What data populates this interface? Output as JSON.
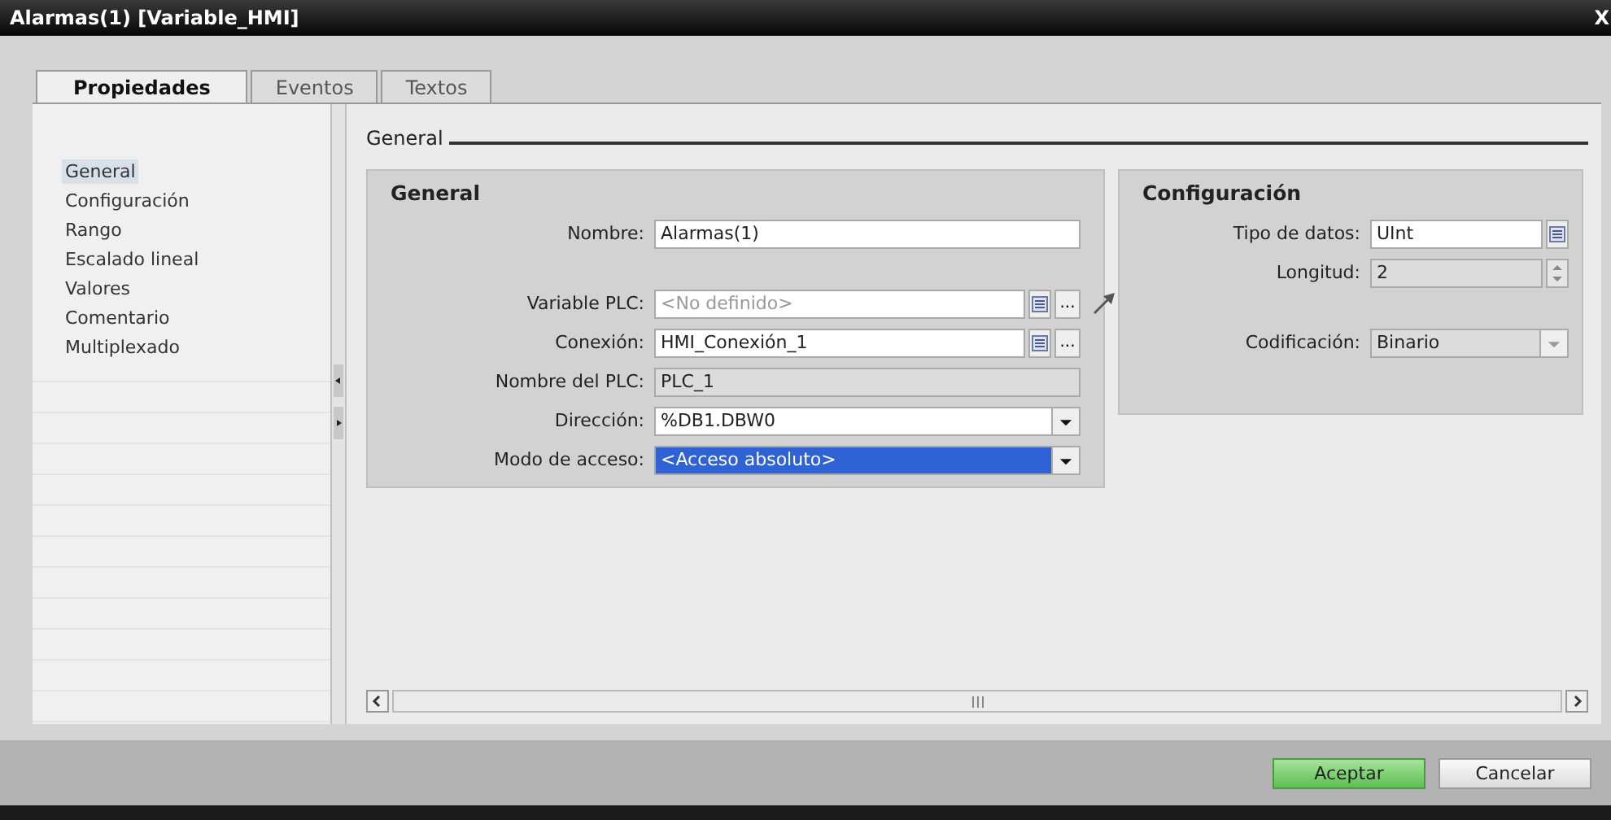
{
  "window": {
    "title": "Alarmas(1) [Variable_HMI]",
    "close": "X"
  },
  "tabs": [
    {
      "label": "Propiedades",
      "selected": true
    },
    {
      "label": "Eventos",
      "selected": false
    },
    {
      "label": "Textos",
      "selected": false
    }
  ],
  "sidebar": {
    "items": [
      {
        "label": "General",
        "selected": true
      },
      {
        "label": "Configuración",
        "selected": false
      },
      {
        "label": "Rango",
        "selected": false
      },
      {
        "label": "Escalado lineal",
        "selected": false
      },
      {
        "label": "Valores",
        "selected": false
      },
      {
        "label": "Comentario",
        "selected": false
      },
      {
        "label": "Multiplexado",
        "selected": false
      }
    ]
  },
  "section_title": "General",
  "groups": [
    {
      "title": "General",
      "sections": [
        [
          {
            "label": "Nombre:",
            "kind": "text",
            "value": "Alarmas(1)"
          }
        ],
        [
          {
            "label": "Variable PLC:",
            "kind": "tag",
            "placeholder": "<No definido>",
            "browse": "...",
            "jump": true
          },
          {
            "label": "Conexión:",
            "kind": "tag",
            "value": "HMI_Conexión_1",
            "browse": "..."
          },
          {
            "label": "Nombre del PLC:",
            "kind": "readonly",
            "value": "PLC_1"
          },
          {
            "label": "Dirección:",
            "kind": "dropdown",
            "value": "%DB1.DBW0",
            "disabled": false,
            "highlighted": false
          },
          {
            "label": "Modo de acceso:",
            "kind": "dropdown",
            "value": "<Acceso absoluto>",
            "disabled": false,
            "highlighted": true
          }
        ]
      ]
    },
    {
      "title": "Configuración",
      "sections": [
        [
          {
            "label": "Tipo de datos:",
            "kind": "tag",
            "value": "UInt"
          },
          {
            "label": "Longitud:",
            "kind": "spinner",
            "value": "2"
          }
        ],
        [
          {
            "label": "Codificación:",
            "kind": "dropdown",
            "value": "Binario",
            "disabled": true,
            "highlighted": false
          }
        ]
      ]
    }
  ],
  "buttons": [
    {
      "label": "Aceptar",
      "primary": true
    },
    {
      "label": "Cancelar",
      "primary": false
    }
  ]
}
